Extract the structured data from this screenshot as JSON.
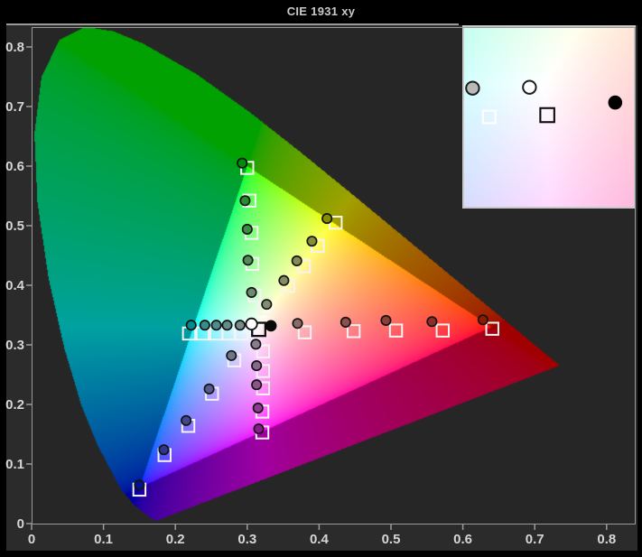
{
  "window": {
    "title": "CIE 1931 xy"
  },
  "axes": {
    "x": {
      "tick_values": [
        0,
        0.1,
        0.2,
        0.3,
        0.4,
        0.5,
        0.6,
        0.7,
        0.8
      ],
      "tick_labels": [
        "0",
        "0.1",
        "0.2",
        "0.3",
        "0.4",
        "0.5",
        "0.6",
        "0.7",
        "0.8"
      ]
    },
    "y": {
      "tick_values": [
        0,
        0.1,
        0.2,
        0.3,
        0.4,
        0.5,
        0.6,
        0.7,
        0.8
      ],
      "tick_labels": [
        "0",
        "0.1",
        "0.2",
        "0.3",
        "0.4",
        "0.5",
        "0.6",
        "0.7",
        "0.8"
      ]
    }
  },
  "colors": {
    "outer_border": "#000000",
    "panel_bg": "#2b2b2b",
    "plot_bg": "#262626",
    "frame": "#9a9a9a",
    "tick_label": "#d6d6d6",
    "title": "#c9c9c9",
    "target_square_stroke": "#f4f4f4",
    "white_target_square_stroke": "#111111",
    "measure_circle_stroke": "#141414",
    "inset_border": "#c8c8c8"
  },
  "chart_data": {
    "type": "scatter",
    "title": "CIE 1931 xy",
    "xlim": [
      0,
      0.84
    ],
    "ylim": [
      0,
      0.833
    ],
    "grid": false,
    "legend": "none",
    "description": "CIE 1931 xy chromaticity horseshoe with Rec.709 gamut triangle shown at full brightness, out-of-gamut colors dimmed, saturation sweep measurements (circles) versus reference targets (squares), white point markers, and a magnified white-point inset panel",
    "spectral_locus": [
      [
        0.1741,
        0.005
      ],
      [
        0.1714,
        0.0051
      ],
      [
        0.1689,
        0.0069
      ],
      [
        0.1644,
        0.0109
      ],
      [
        0.1566,
        0.0177
      ],
      [
        0.144,
        0.0297
      ],
      [
        0.1241,
        0.0578
      ],
      [
        0.0913,
        0.1327
      ],
      [
        0.0687,
        0.2007
      ],
      [
        0.0454,
        0.295
      ],
      [
        0.0235,
        0.4127
      ],
      [
        0.0082,
        0.5384
      ],
      [
        0.0039,
        0.6548
      ],
      [
        0.0139,
        0.7502
      ],
      [
        0.0389,
        0.812
      ],
      [
        0.0743,
        0.8338
      ],
      [
        0.1142,
        0.8262
      ],
      [
        0.1547,
        0.8059
      ],
      [
        0.2296,
        0.7543
      ],
      [
        0.3016,
        0.6923
      ],
      [
        0.3731,
        0.6245
      ],
      [
        0.4441,
        0.5547
      ],
      [
        0.5125,
        0.4866
      ],
      [
        0.5752,
        0.4242
      ],
      [
        0.627,
        0.3725
      ],
      [
        0.6658,
        0.334
      ],
      [
        0.6915,
        0.3083
      ],
      [
        0.714,
        0.2859
      ],
      [
        0.726,
        0.274
      ],
      [
        0.7347,
        0.2653
      ]
    ],
    "gamut_triangle": {
      "red": [
        0.64,
        0.33
      ],
      "green": [
        0.3,
        0.6
      ],
      "blue": [
        0.15,
        0.06
      ]
    },
    "outside_gamut_dim": 0.63,
    "series": [
      {
        "name": "red",
        "measured": [
          [
            0.37,
            0.336
          ],
          [
            0.437,
            0.338
          ],
          [
            0.493,
            0.341
          ],
          [
            0.557,
            0.339
          ],
          [
            0.628,
            0.342
          ]
        ],
        "targets": [
          [
            0.38,
            0.321
          ],
          [
            0.448,
            0.323
          ],
          [
            0.507,
            0.324
          ],
          [
            0.572,
            0.324
          ],
          [
            0.641,
            0.327
          ]
        ]
      },
      {
        "name": "yellow",
        "measured": [
          [
            0.327,
            0.368
          ],
          [
            0.351,
            0.408
          ],
          [
            0.369,
            0.441
          ],
          [
            0.39,
            0.474
          ],
          [
            0.411,
            0.512
          ]
        ],
        "targets": [
          [
            0.325,
            0.362
          ],
          [
            0.357,
            0.399
          ],
          [
            0.379,
            0.432
          ],
          [
            0.398,
            0.466
          ],
          [
            0.423,
            0.505
          ]
        ]
      },
      {
        "name": "green",
        "measured": [
          [
            0.306,
            0.388
          ],
          [
            0.301,
            0.442
          ],
          [
            0.3,
            0.494
          ],
          [
            0.297,
            0.542
          ],
          [
            0.293,
            0.605
          ]
        ],
        "targets": [
          [
            0.31,
            0.383
          ],
          [
            0.307,
            0.436
          ],
          [
            0.306,
            0.488
          ],
          [
            0.303,
            0.542
          ],
          [
            0.3,
            0.597
          ]
        ]
      },
      {
        "name": "cyan",
        "measured": [
          [
            0.29,
            0.333
          ],
          [
            0.272,
            0.333
          ],
          [
            0.257,
            0.333
          ],
          [
            0.241,
            0.333
          ],
          [
            0.222,
            0.333
          ]
        ],
        "targets": [
          [
            0.292,
            0.319
          ],
          [
            0.274,
            0.319
          ],
          [
            0.257,
            0.319
          ],
          [
            0.238,
            0.319
          ],
          [
            0.219,
            0.319
          ]
        ]
      },
      {
        "name": "blue",
        "measured": [
          [
            0.278,
            0.282
          ],
          [
            0.247,
            0.226
          ],
          [
            0.215,
            0.173
          ],
          [
            0.184,
            0.124
          ],
          [
            0.15,
            0.065
          ]
        ],
        "targets": [
          [
            0.282,
            0.274
          ],
          [
            0.251,
            0.218
          ],
          [
            0.218,
            0.164
          ],
          [
            0.185,
            0.115
          ],
          [
            0.15,
            0.057
          ]
        ]
      },
      {
        "name": "magenta",
        "measured": [
          [
            0.312,
            0.301
          ],
          [
            0.313,
            0.265
          ],
          [
            0.313,
            0.233
          ],
          [
            0.315,
            0.194
          ],
          [
            0.316,
            0.159
          ]
        ],
        "targets": [
          [
            0.322,
            0.289
          ],
          [
            0.322,
            0.256
          ],
          [
            0.322,
            0.227
          ],
          [
            0.321,
            0.188
          ],
          [
            0.321,
            0.153
          ]
        ]
      }
    ],
    "white_point": {
      "target": [
        0.316,
        0.326
      ],
      "measured_dot": [
        0.333,
        0.332
      ],
      "measured_circle": [
        0.306,
        0.335
      ]
    },
    "inset": {
      "x_range": [
        0.2875,
        0.3405
      ],
      "y_range": [
        0.293,
        0.346
      ],
      "points": [
        {
          "type": "circle",
          "fill": "#b9b9b9",
          "fx": 0.05,
          "fy": 0.34,
          "name": "inset-gray-measure-circle"
        },
        {
          "type": "circle",
          "fill": "#ffffff",
          "fx": 0.385,
          "fy": 0.335,
          "name": "inset-white-measure-circle"
        },
        {
          "type": "dot",
          "fill": "#000000",
          "fx": 0.89,
          "fy": 0.42,
          "name": "inset-black-measured-dot"
        },
        {
          "type": "square",
          "stroke": "#ffffff",
          "fx": 0.148,
          "fy": 0.5,
          "name": "inset-white-target-square"
        },
        {
          "type": "square",
          "stroke": "#0d0d0d",
          "fx": 0.49,
          "fy": 0.49,
          "name": "inset-black-target-square"
        }
      ]
    }
  }
}
